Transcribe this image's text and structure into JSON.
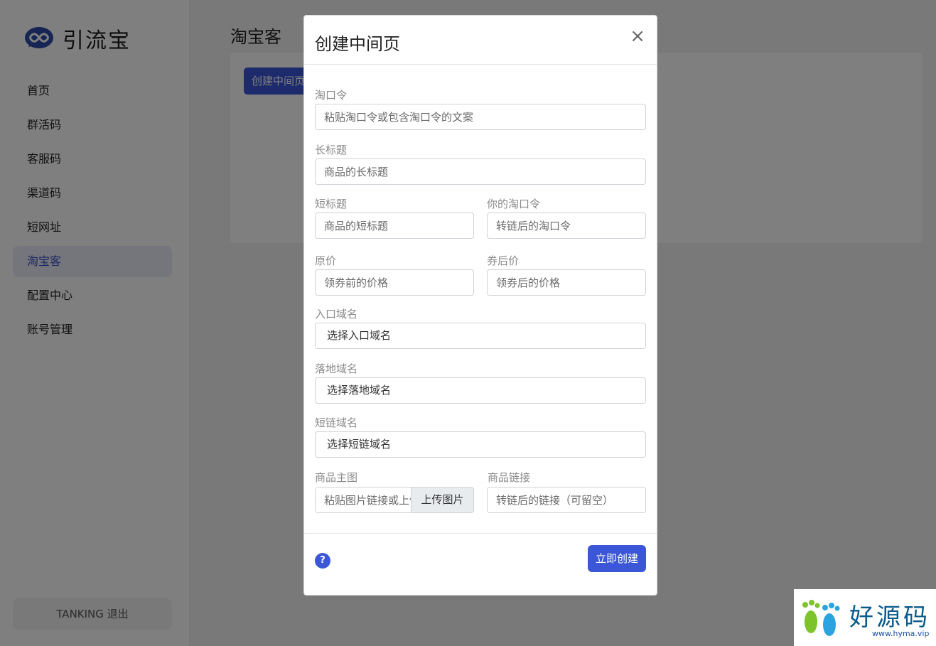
{
  "sidebar": {
    "logo_text": "引流宝",
    "items": [
      {
        "label": "首页"
      },
      {
        "label": "群活码"
      },
      {
        "label": "客服码"
      },
      {
        "label": "渠道码"
      },
      {
        "label": "短网址"
      },
      {
        "label": "淘宝客",
        "active": true
      },
      {
        "label": "配置中心"
      },
      {
        "label": "账号管理"
      }
    ],
    "user": "TANKING  退出"
  },
  "main": {
    "title": "淘宝客",
    "create_button": "创建中间页"
  },
  "modal": {
    "title": "创建中间页",
    "close_icon": "×",
    "fields": {
      "taokouling": {
        "label": "淘口令",
        "placeholder": "粘贴淘口令或包含淘口令的文案"
      },
      "long_title": {
        "label": "长标题",
        "placeholder": "商品的长标题"
      },
      "short_title": {
        "label": "短标题",
        "placeholder": "商品的短标题"
      },
      "your_taokouling": {
        "label": "你的淘口令",
        "placeholder": "转链后的淘口令"
      },
      "original_price": {
        "label": "原价",
        "placeholder": "领券前的价格"
      },
      "coupon_price": {
        "label": "券后价",
        "placeholder": "领券后的价格"
      },
      "entry_domain": {
        "label": "入口域名",
        "value": "选择入口域名"
      },
      "landing_domain": {
        "label": "落地域名",
        "value": "选择落地域名"
      },
      "short_domain": {
        "label": "短链域名",
        "value": "选择短链域名"
      },
      "main_image": {
        "label": "商品主图",
        "placeholder": "粘贴图片链接或上传",
        "upload_label": "上传图片"
      },
      "product_link": {
        "label": "商品链接",
        "placeholder": "转链后的链接（可留空）"
      }
    },
    "help_icon": "?",
    "submit_label": "立即创建"
  },
  "watermark": {
    "text": "好源码",
    "url": "www.hyma.vip"
  },
  "colors": {
    "accent": "#3b57d8",
    "overlay": "rgba(0,0,0,0.5)",
    "active_nav_bg": "#e8ecf7"
  }
}
